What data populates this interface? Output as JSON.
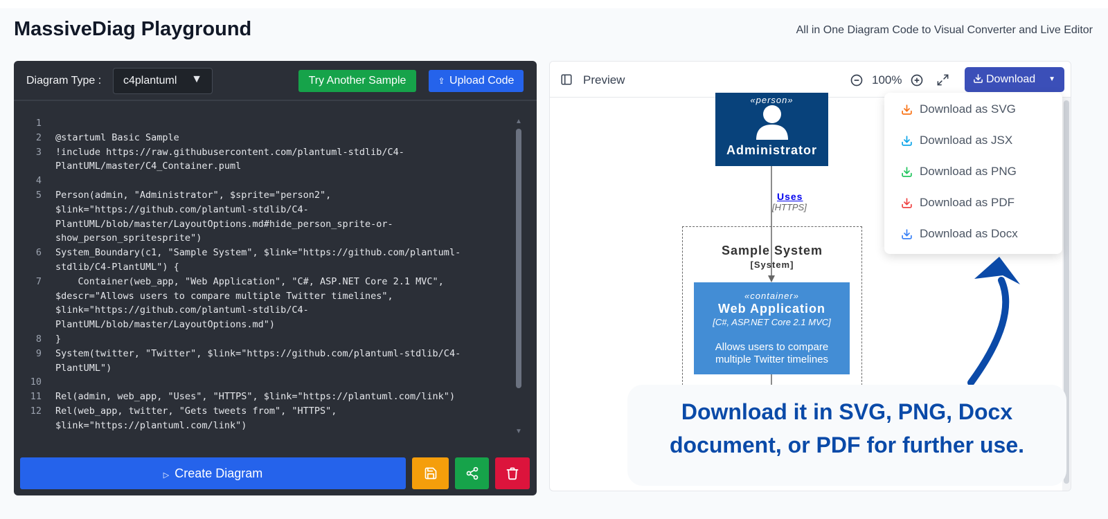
{
  "header": {
    "title": "MassiveDiag Playground",
    "subtitle": "All in One Diagram Code to Visual Converter and Live Editor"
  },
  "editor": {
    "diagram_type_label": "Diagram Type :",
    "diagram_type_value": "c4plantuml",
    "try_sample_label": "Try Another Sample",
    "upload_label": "Upload Code",
    "create_label": "Create Diagram",
    "code_lines": [
      {
        "n": "1",
        "text": ""
      },
      {
        "n": "2",
        "text": "@startuml Basic Sample"
      },
      {
        "n": "3",
        "text": "!include https://raw.githubusercontent.com/plantuml-stdlib/C4-\nPlantUML/master/C4_Container.puml"
      },
      {
        "n": "4",
        "text": ""
      },
      {
        "n": "5",
        "text": "Person(admin, \"Administrator\", $sprite=\"person2\",\n$link=\"https://github.com/plantuml-stdlib/C4-\nPlantUML/blob/master/LayoutOptions.md#hide_person_sprite-or-\nshow_person_spritesprite\")"
      },
      {
        "n": "6",
        "text": "System_Boundary(c1, \"Sample System\", $link=\"https://github.com/plantuml-\nstdlib/C4-PlantUML\") {"
      },
      {
        "n": "7",
        "text": "    Container(web_app, \"Web Application\", \"C#, ASP.NET Core 2.1 MVC\",\n$descr=\"Allows users to compare multiple Twitter timelines\",\n$link=\"https://github.com/plantuml-stdlib/C4-\nPlantUML/blob/master/LayoutOptions.md\")"
      },
      {
        "n": "8",
        "text": "}"
      },
      {
        "n": "9",
        "text": "System(twitter, \"Twitter\", $link=\"https://github.com/plantuml-stdlib/C4-\nPlantUML\")"
      },
      {
        "n": "10",
        "text": ""
      },
      {
        "n": "11",
        "text": "Rel(admin, web_app, \"Uses\", \"HTTPS\", $link=\"https://plantuml.com/link\")"
      },
      {
        "n": "12",
        "text": "Rel(web_app, twitter, \"Gets tweets from\", \"HTTPS\",\n$link=\"https://plantuml.com/link\")"
      }
    ]
  },
  "preview": {
    "label": "Preview",
    "zoom": "100%",
    "download_label": "Download",
    "download_options": [
      {
        "label": "Download as SVG",
        "color": "#f97316"
      },
      {
        "label": "Download as JSX",
        "color": "#0ea5e9"
      },
      {
        "label": "Download as PNG",
        "color": "#22c55e"
      },
      {
        "label": "Download as PDF",
        "color": "#ef4444"
      },
      {
        "label": "Download as Docx",
        "color": "#3b82f6"
      }
    ]
  },
  "diagram": {
    "person_stereotype": "«person»",
    "person_name": "Administrator",
    "rel_label": "Uses",
    "rel_tech": "[HTTPS]",
    "boundary_name": "Sample System",
    "boundary_type": "[System]",
    "container_stereotype": "«container»",
    "container_name": "Web Application",
    "container_tech": "[C#, ASP.NET Core 2.1 MVC]",
    "container_descr": "Allows users to compare multiple Twitter timelines"
  },
  "callout": {
    "line1": "Download it in SVG, PNG, Docx",
    "line2": "document, or PDF for further use."
  },
  "colors": {
    "accent_blue": "#2563eb",
    "success_green": "#16a34a",
    "warning_amber": "#f59e0b",
    "danger_red": "#dc143c",
    "download_indigo": "#3b4fb8",
    "c4_person": "#08427b",
    "c4_container": "#438dd5",
    "callout_text": "#0a4aa8"
  }
}
